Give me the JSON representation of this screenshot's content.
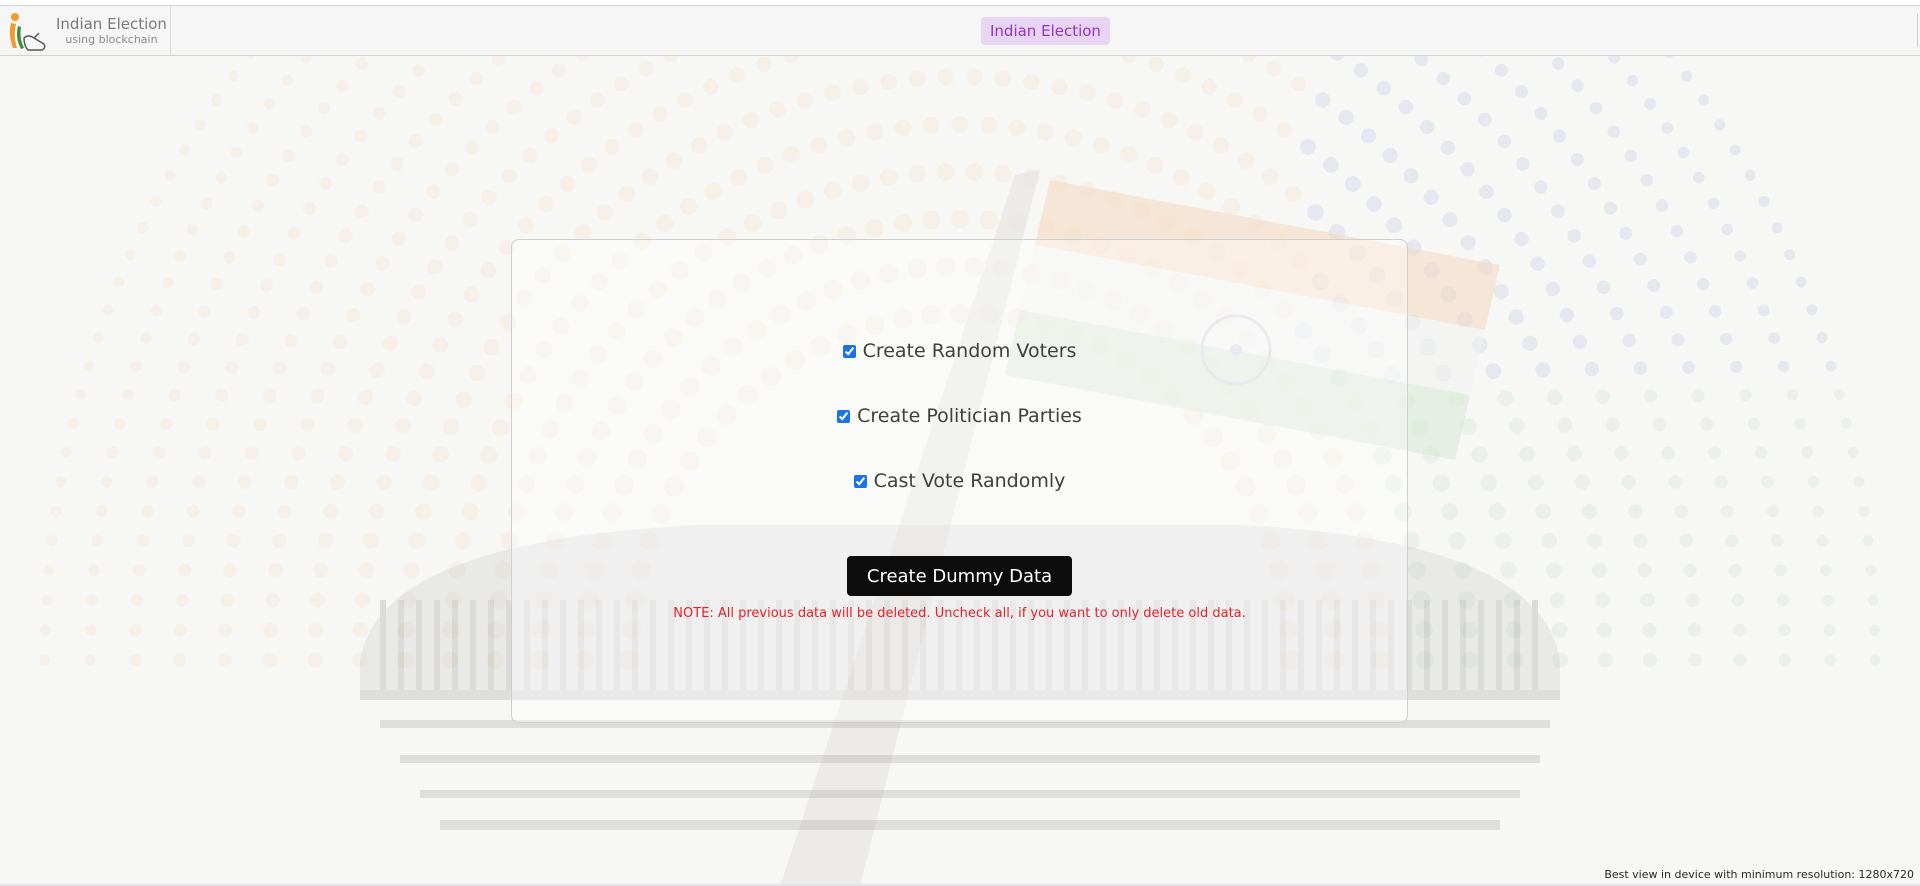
{
  "header": {
    "brand_title": "Indian Election",
    "brand_subtitle": "using blockchain",
    "nav_pill": "Indian Election",
    "logo_icon": "voter-hand-logo-icon"
  },
  "form": {
    "options": [
      {
        "label": "Create Random Voters",
        "checked": true
      },
      {
        "label": "Create Politician Parties",
        "checked": true
      },
      {
        "label": "Cast Vote Randomly",
        "checked": true
      }
    ],
    "submit_label": "Create Dummy Data",
    "note": "NOTE: All previous data will be deleted. Uncheck all, if you want to only delete old data."
  },
  "footer": {
    "resolution_note": "Best view in device with minimum resolution: 1280x720"
  },
  "colors": {
    "accent_pill_bg": "#e8d5f3",
    "accent_pill_text": "#9334c7",
    "button_bg": "#0c0c0c",
    "note_text": "#e2222a",
    "saffron": "#f4b267",
    "green": "#7fbf7f",
    "navy": "#3b5bb5"
  }
}
